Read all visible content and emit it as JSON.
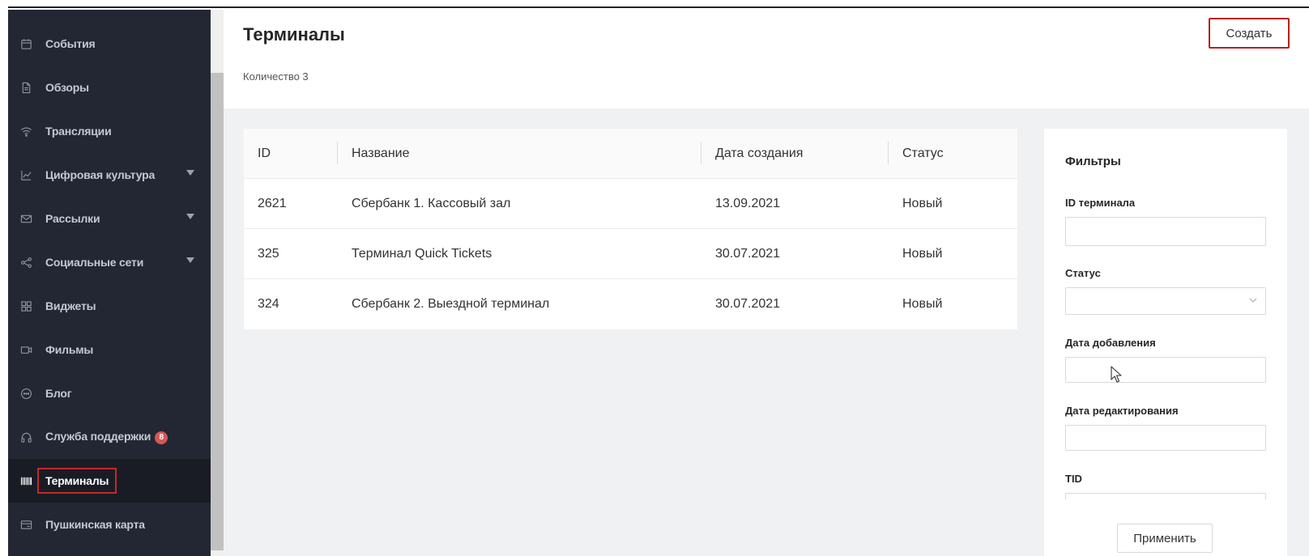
{
  "sidebar": {
    "items": [
      {
        "label": "События",
        "icon": "calendar-icon"
      },
      {
        "label": "Обзоры",
        "icon": "document-icon"
      },
      {
        "label": "Трансляции",
        "icon": "wifi-icon"
      },
      {
        "label": "Цифровая культура",
        "icon": "line-chart-icon",
        "expandable": true
      },
      {
        "label": "Рассылки",
        "icon": "mail-icon",
        "expandable": true
      },
      {
        "label": "Социальные сети",
        "icon": "share-icon",
        "expandable": true
      },
      {
        "label": "Виджеты",
        "icon": "grid-icon"
      },
      {
        "label": "Фильмы",
        "icon": "video-camera-icon"
      },
      {
        "label": "Блог",
        "icon": "chat-bubble-icon"
      },
      {
        "label": "Служба поддержки",
        "icon": "headphones-icon",
        "badge": "8"
      },
      {
        "label": "Терминалы",
        "icon": "barcode-icon",
        "active": true
      },
      {
        "label": "Пушкинская карта",
        "icon": "card-icon"
      }
    ]
  },
  "header": {
    "title": "Терминалы",
    "count_text": "Количество 3",
    "create_label": "Создать"
  },
  "table": {
    "columns": [
      "ID",
      "Название",
      "Дата создания",
      "Статус"
    ],
    "rows": [
      {
        "id": "2621",
        "name": "Сбербанк 1. Кассовый зал",
        "date": "13.09.2021",
        "status": "Новый"
      },
      {
        "id": "325",
        "name": "Терминал Quick Tickets",
        "date": "30.07.2021",
        "status": "Новый"
      },
      {
        "id": "324",
        "name": "Сбербанк 2. Выездной терминал",
        "date": "30.07.2021",
        "status": "Новый"
      }
    ]
  },
  "filters": {
    "title": "Фильтры",
    "terminal_id_label": "ID терминала",
    "status_label": "Статус",
    "added_date_label": "Дата добавления",
    "edited_date_label": "Дата редактирования",
    "tid_label": "TID",
    "apply_label": "Применить"
  },
  "colors": {
    "sidebar_bg": "#232733",
    "sidebar_active_bg": "#191c25",
    "highlight_red": "#c62828",
    "badge_red": "#d65656",
    "content_bg": "#f0f1f3"
  }
}
